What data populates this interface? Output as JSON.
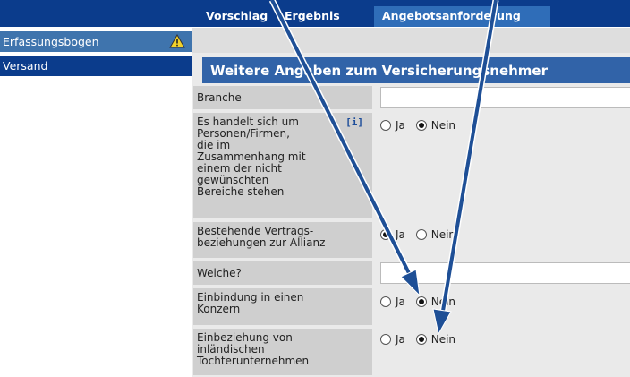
{
  "top_nav": {
    "tabs": [
      {
        "label": "Vorschlag"
      },
      {
        "label": "Ergebnis"
      },
      {
        "label": "Angebotsanforderung"
      }
    ]
  },
  "sidebar": {
    "items": [
      {
        "label": "Erfassungsbogen",
        "icon": "warning-icon"
      },
      {
        "label": "Versand"
      }
    ]
  },
  "section": {
    "title": "Weitere Angaben zum Versicherungsnehmer"
  },
  "form": {
    "branche": {
      "label": "Branche",
      "value": ""
    },
    "excluded": {
      "label_lines": [
        "Es handelt sich um",
        "Personen/Firmen,",
        "die im",
        "Zusammenhang mit",
        "einem der nicht",
        "gewünschten",
        "Bereiche stehen"
      ],
      "info": "[i]",
      "yes": "Ja",
      "no": "Nein",
      "selected": "no"
    },
    "relations": {
      "label_lines": [
        "Bestehende Vertrags-",
        "beziehungen zur Allianz"
      ],
      "yes": "Ja",
      "no": "Nein",
      "selected": "yes"
    },
    "welche": {
      "label": "Welche?",
      "value": ""
    },
    "konzern": {
      "label_lines": [
        "Einbindung in einen",
        "Konzern"
      ],
      "yes": "Ja",
      "no": "Nein",
      "selected": "no"
    },
    "tochter": {
      "label_lines": [
        "Einbeziehung von",
        "inländischen",
        "Tochterunternehmen"
      ],
      "yes": "Ja",
      "no": "Nein",
      "selected": "no"
    }
  },
  "colors": {
    "nav": "#0b3c8c",
    "section_header": "#3163a8",
    "arrow": "#1e4f96"
  }
}
